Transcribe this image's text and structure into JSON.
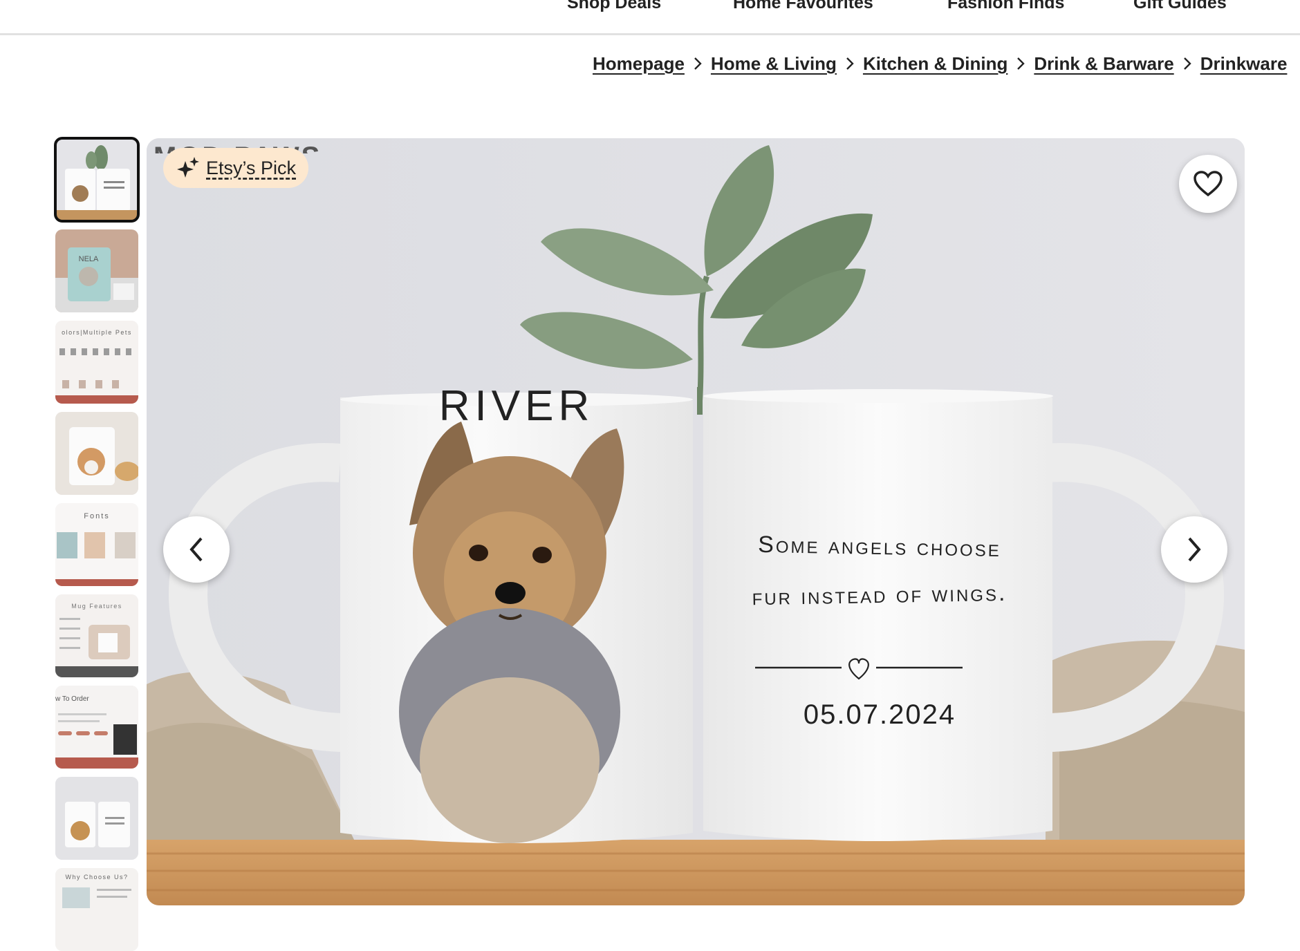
{
  "nav": {
    "items": [
      "Shop Deals",
      "Home Favourites",
      "Fashion Finds",
      "Gift Guides"
    ]
  },
  "breadcrumbs": [
    "Homepage",
    "Home & Living",
    "Kitchen & Dining",
    "Drink & Barware",
    "Drinkware"
  ],
  "gallery": {
    "shop_name_partial": "MOD PAWS",
    "badge": "Etsy’s Pick",
    "mug_left_name": "RIVER",
    "mug_right_line1": "Some angels choose",
    "mug_right_line2": "fur instead of wings.",
    "mug_right_date": "05.07.2024",
    "thumbnail_count": 9,
    "thumb_texts": {
      "t2": "NELA",
      "t3": "olors|Multiple Pets",
      "t5": "Fonts",
      "t6": "Mug Features",
      "t7": "w To Order",
      "t9": "Why Choose Us?"
    }
  },
  "colors": {
    "badge_bg": "#fde8cf",
    "text": "#222222",
    "divider": "#e1e1e1"
  },
  "icons": {
    "favorite": "heart-outline-icon",
    "prev": "chevron-left-icon",
    "next": "chevron-right-icon",
    "badge": "sparkle-icon",
    "separator": "chevron-right-small-icon"
  }
}
